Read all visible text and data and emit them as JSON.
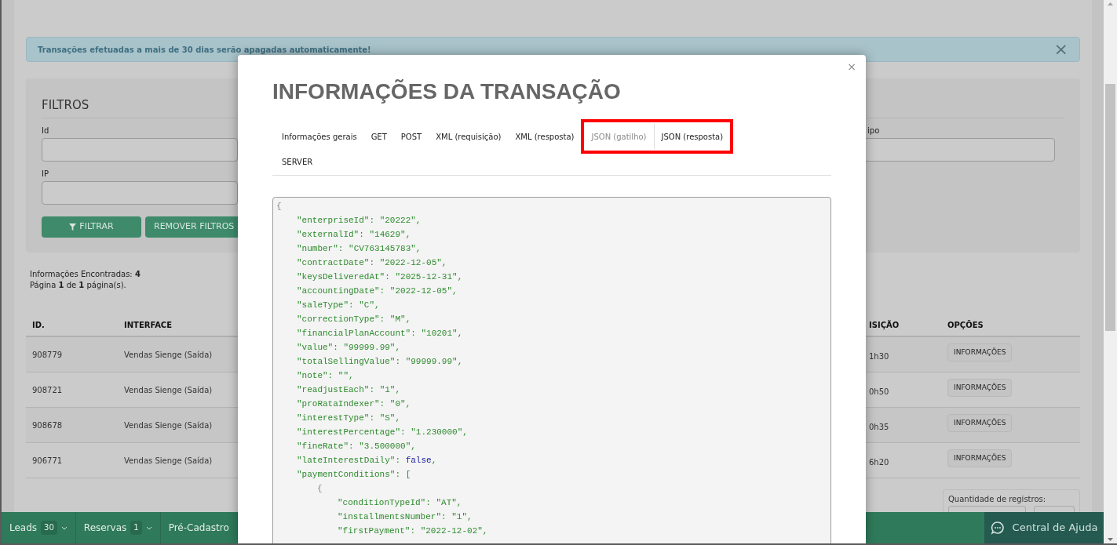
{
  "alert": {
    "text": "Transações efetuadas a mais de 30 dias serão apagadas automaticamente!",
    "close": "×"
  },
  "filters": {
    "title": "FILTROS",
    "left_fields": [
      {
        "label": "Id"
      },
      {
        "label": "IP"
      }
    ],
    "right_fields": [
      {
        "label": "ipo"
      }
    ],
    "buttons": [
      {
        "label": "FILTRAR",
        "kind": "filter"
      },
      {
        "label": "REMOVER FILTROS",
        "kind": "plain"
      }
    ]
  },
  "summary": {
    "found": "Informações Encontradas: **4**",
    "page": "Página **1** de **1** página(s)."
  },
  "table": {
    "columns": [
      "ID.",
      "INTERFACE",
      "ISIÇÃO",
      "OPÇÕES"
    ],
    "rows": [
      {
        "id": "908779",
        "interface": "Vendas Sienge (Saída)",
        "column_3": "1h30",
        "action": "INFORMAÇÕES"
      },
      {
        "id": "908721",
        "interface": "Vendas Sienge (Saída)",
        "column_3": "0h50",
        "action": "INFORMAÇÕES"
      },
      {
        "id": "908678",
        "interface": "Vendas Sienge (Saída)",
        "column_3": "0h35",
        "action": "INFORMAÇÕES"
      },
      {
        "id": "906771",
        "interface": "Vendas Sienge (Saída)",
        "column_3": "6h20",
        "action": "INFORMAÇÕES"
      }
    ]
  },
  "page_size": {
    "label": "Quantidade de registros:"
  },
  "footer": {
    "items": [
      {
        "label": "Leads",
        "count": "30"
      },
      {
        "label": "Reservas",
        "count": "1"
      },
      {
        "label": "Pré-Cadastro"
      }
    ],
    "help": "Central de Ajuda"
  },
  "modal": {
    "title": "INFORMAÇÕES DA TRANSAÇÃO",
    "close": "×",
    "tabs": [
      {
        "label": "Informações gerais",
        "selected": false,
        "highlighted": false
      },
      {
        "label": "GET",
        "selected": false,
        "highlighted": false
      },
      {
        "label": "POST",
        "selected": false,
        "highlighted": false
      },
      {
        "label": "XML (requisição)",
        "selected": false,
        "highlighted": false
      },
      {
        "label": "XML (resposta)",
        "selected": false,
        "highlighted": false
      },
      {
        "label": "JSON (gatilho)",
        "selected": true,
        "highlighted": true
      },
      {
        "label": "JSON (resposta)",
        "selected": false,
        "highlighted": true
      },
      {
        "label": "SERVER",
        "selected": false,
        "highlighted": false
      }
    ],
    "code": {
      "open": "{",
      "entries": [
        {
          "key": "\"enterpriseId\":",
          "value": "\"20222\","
        },
        {
          "key": "\"externalId\":",
          "value": "\"14629\","
        },
        {
          "key": "\"number\":",
          "value": "\"CV763145783\","
        },
        {
          "key": "\"contractDate\":",
          "value": "\"2022-12-05\","
        },
        {
          "key": "\"keysDeliveredAt\":",
          "value": "\"2025-12-31\","
        },
        {
          "key": "\"accountingDate\":",
          "value": "\"2022-12-05\","
        },
        {
          "key": "\"saleType\":",
          "value": "\"C\","
        },
        {
          "key": "\"correctionType\":",
          "value": "\"M\","
        },
        {
          "key": "\"financialPlanAccount\":",
          "value": "\"10201\","
        },
        {
          "key": "\"value\":",
          "value": "\"99999.99\","
        },
        {
          "key": "\"totalSellingValue\":",
          "value": "\"99999.99\","
        },
        {
          "key": "\"note\":",
          "value": "\"\","
        },
        {
          "key": "\"readjustEach\":",
          "value": "\"1\","
        },
        {
          "key": "\"proRataIndexer\":",
          "value": "\"0\","
        },
        {
          "key": "\"interestType\":",
          "value": "\"S\","
        },
        {
          "key": "\"interestPercentage\":",
          "value": "\"1.230000\","
        },
        {
          "key": "\"fineRate\":",
          "value": "\"3.500000\","
        },
        {
          "key": "\"lateInterestDaily\":",
          "value": "false",
          "tail": ",",
          "kind": "literal"
        },
        {
          "key": "\"paymentConditions\":",
          "value": "[",
          "children": [
            {
              "open": "{",
              "entries": [
                {
                  "key": "\"conditionTypeId\":",
                  "value": "\"AT\","
                },
                {
                  "key": "\"installmentsNumber\":",
                  "value": "\"1\","
                },
                {
                  "key": "\"firstPayment\":",
                  "value": "\"2022-12-02\","
                }
              ]
            }
          ]
        }
      ]
    }
  }
}
